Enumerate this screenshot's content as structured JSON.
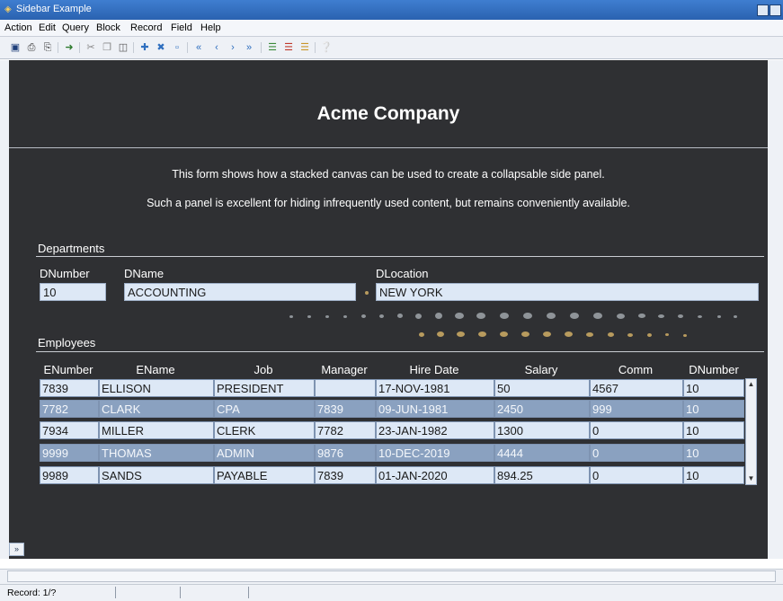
{
  "window": {
    "title": "Sidebar Example"
  },
  "menu": [
    "Action",
    "Edit",
    "Query",
    "Block",
    "Record",
    "Field",
    "Help"
  ],
  "toolbar_icons": [
    "save-icon",
    "print-icon",
    "print-setup-icon",
    "exit-icon",
    "cut-icon",
    "copy-icon",
    "paste-icon",
    "insert-record-icon",
    "delete-record-icon",
    "clear-record-icon",
    "first-record-icon",
    "previous-record-icon",
    "next-record-icon",
    "last-record-icon",
    "enter-query-icon",
    "execute-query-icon",
    "cancel-query-icon",
    "help-icon"
  ],
  "form": {
    "company": "Acme Company",
    "desc1": "This form shows how a stacked canvas can be used to create a collapsable side panel.",
    "desc2": "Such a panel is excellent for hiding infrequently used content, but remains conveniently available."
  },
  "departments": {
    "label": "Departments",
    "fields": [
      {
        "label": "DNumber",
        "value": "10"
      },
      {
        "label": "DName",
        "value": "ACCOUNTING"
      },
      {
        "label": "DLocation",
        "value": "NEW YORK"
      }
    ]
  },
  "employees": {
    "label": "Employees",
    "columns": [
      "ENumber",
      "EName",
      "Job",
      "Manager",
      "Hire Date",
      "Salary",
      "Comm",
      "DNumber"
    ],
    "rows": [
      [
        "7839",
        "ELLISON",
        "PRESIDENT",
        "",
        "17-NOV-1981",
        "50",
        "4567",
        "10"
      ],
      [
        "7782",
        "CLARK",
        "CPA",
        "7839",
        "09-JUN-1981",
        "2450",
        "999",
        "10"
      ],
      [
        "7934",
        "MILLER",
        "CLERK",
        "7782",
        "23-JAN-1982",
        "1300",
        "0",
        "10"
      ],
      [
        "9999",
        "THOMAS",
        "ADMIN",
        "9876",
        "10-DEC-2019",
        "4444",
        "0",
        "10"
      ],
      [
        "9989",
        "SANDS",
        "PAYABLE",
        "7839",
        "01-JAN-2020",
        "894.25",
        "0",
        "10"
      ]
    ]
  },
  "status": {
    "record": "Record: 1/?"
  },
  "colors": {
    "canvas": "#2f3033",
    "field": "#dde8f6",
    "row_alt": "#8aa1c0",
    "titlebar": "#2a62b0"
  }
}
